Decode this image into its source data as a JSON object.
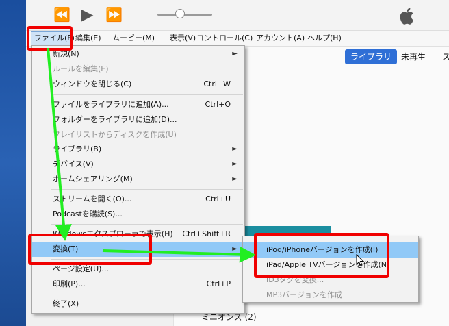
{
  "menubar": [
    "ファイル(F)",
    "編集(E)",
    "ムービー(M)",
    "表示(V)",
    "コントロール(C)",
    "アカウント(A)",
    "ヘルプ(H)"
  ],
  "tabs": [
    "ライブラリ",
    "未再生",
    "ス"
  ],
  "file_menu": [
    {
      "label": "新規(N)",
      "shortcut": "",
      "arrow": true,
      "disabled": false
    },
    {
      "label": "ルールを編集(E)",
      "shortcut": "",
      "arrow": false,
      "disabled": true
    },
    {
      "label": "ウィンドウを閉じる(C)",
      "shortcut": "Ctrl+W",
      "arrow": false,
      "disabled": false
    },
    {
      "label": "ファイルをライブラリに追加(A)...",
      "shortcut": "Ctrl+O",
      "arrow": false,
      "disabled": false
    },
    {
      "label": "フォルダーをライブラリに追加(D)...",
      "shortcut": "",
      "arrow": false,
      "disabled": false
    },
    {
      "label": "プレイリストからディスクを作成(U)",
      "shortcut": "",
      "arrow": false,
      "disabled": true
    },
    {
      "label": "ライブラリ(B)",
      "shortcut": "",
      "arrow": true,
      "disabled": false
    },
    {
      "label": "デバイス(V)",
      "shortcut": "",
      "arrow": true,
      "disabled": false
    },
    {
      "label": "ホームシェアリング(M)",
      "shortcut": "",
      "arrow": true,
      "disabled": false
    },
    {
      "label": "ストリームを開く(O)...",
      "shortcut": "Ctrl+U",
      "arrow": false,
      "disabled": false
    },
    {
      "label": "Podcastを購読(S)...",
      "shortcut": "",
      "arrow": false,
      "disabled": false
    },
    {
      "label": "Windowsエクスプローラで表示(H)",
      "shortcut": "Ctrl+Shift+R",
      "arrow": false,
      "disabled": false
    },
    {
      "label": "変換(T)",
      "shortcut": "",
      "arrow": true,
      "disabled": false
    },
    {
      "label": "ページ設定(U)...",
      "shortcut": "",
      "arrow": false,
      "disabled": false
    },
    {
      "label": "印刷(P)...",
      "shortcut": "Ctrl+P",
      "arrow": false,
      "disabled": false
    },
    {
      "label": "終了(X)",
      "shortcut": "",
      "arrow": false,
      "disabled": false
    }
  ],
  "convert_submenu": [
    {
      "label": "iPod/iPhoneバージョンを作成(I)",
      "disabled": false
    },
    {
      "label": "iPad/Apple TVバージョンを作成(N)",
      "disabled": false
    },
    {
      "label": "ID3タグを変換...",
      "disabled": true
    },
    {
      "label": "MP3バージョンを作成",
      "disabled": true
    }
  ],
  "bottom_text": "ミニオンズ (2)",
  "colors": {
    "highlight_box": "#f00000",
    "arrow": "#22ee22",
    "menu_highlight": "#91c9f7",
    "tab_selected": "#2f6fd6"
  }
}
